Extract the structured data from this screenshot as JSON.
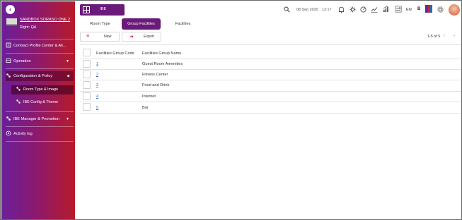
{
  "sidebar": {
    "property_name": "SANDBOX SORASO ONE 2",
    "right_label": "Right: QA",
    "items": [
      {
        "label": "Contract Profile Center & All...",
        "icon": "contract-icon"
      },
      {
        "label": "Operation",
        "icon": "operation-icon"
      },
      {
        "label": "Configuration & Policy",
        "icon": "config-icon"
      },
      {
        "label": "Room Type & Image",
        "icon": "room-type-icon"
      },
      {
        "label": "IBE Config & Theme",
        "icon": "ibe-config-icon"
      },
      {
        "label": "IBE Manager & Promotion",
        "icon": "ibe-manager-icon"
      },
      {
        "label": "Activity log",
        "icon": "activity-log-icon"
      }
    ],
    "gradient_start": "#6a1f9a",
    "gradient_end": "#b81a2a"
  },
  "header": {
    "module_label": "IBE",
    "date": "08 Sep 2020",
    "time": "12:17",
    "lang": "EN",
    "b_label": "B"
  },
  "tabs": [
    "Room Type",
    "Group Facilities",
    "Facilities"
  ],
  "toolbar": {
    "new_label": "New",
    "export_label": "Export",
    "pager_text": "1-5 of 5"
  },
  "table": {
    "columns": [
      "Facilities Group Code",
      "Facilities Group Name"
    ],
    "rows": [
      {
        "code": "1",
        "name": "Guest Room Amenities"
      },
      {
        "code": "2",
        "name": "Fitness Center"
      },
      {
        "code": "3",
        "name": "Food and Drink"
      },
      {
        "code": "4",
        "name": "Internet"
      },
      {
        "code": "5",
        "name": "Bar"
      }
    ]
  },
  "accent_color": "#6a1a78"
}
